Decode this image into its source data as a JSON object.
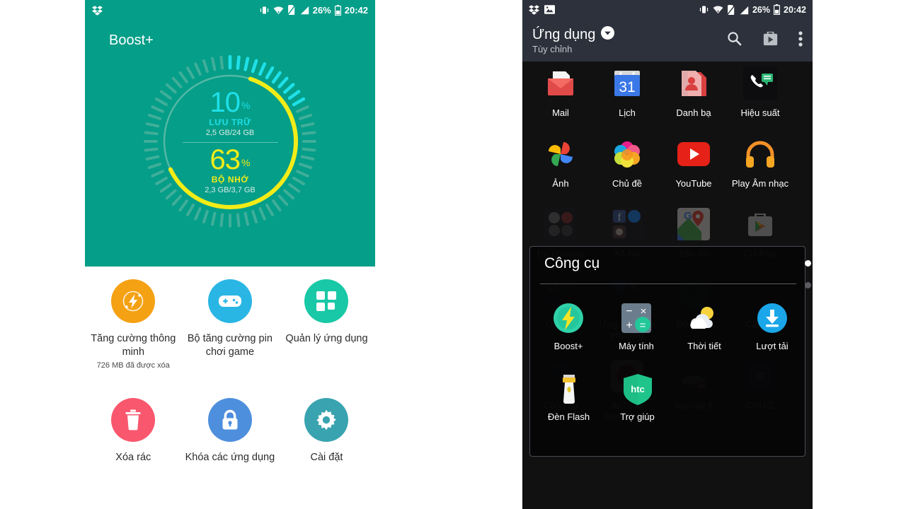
{
  "left_phone": {
    "statusbar": {
      "left_icons": [
        "dropbox-icon"
      ],
      "right_icons": [
        "vibrate-icon",
        "wifi-icon",
        "sd-off-icon",
        "signal-off-icon"
      ],
      "battery_percent": "26%",
      "clock": "20:42"
    },
    "app_title": "Boost+",
    "gauge": {
      "storage": {
        "percent": "10",
        "symbol": "%",
        "label": "LƯU TRỮ",
        "detail": "2,5 GB/24 GB",
        "color": "#1ee0e8",
        "value": 10
      },
      "memory": {
        "percent": "63",
        "symbol": "%",
        "label": "BỘ NHỚ",
        "detail": "2,3 GB/3,7 GB",
        "color": "#f3ec18",
        "value": 63
      }
    },
    "tiles": [
      {
        "label": "Tăng cường thông minh",
        "sub": "726 MB đã được xóa",
        "color": "#f5a114",
        "icon": "boost-bolt-icon"
      },
      {
        "label": "Bộ tăng cường pin chơi game",
        "sub": "",
        "color": "#29b6e5",
        "icon": "gamepad-icon"
      },
      {
        "label": "Quản lý ứng dụng",
        "sub": "",
        "color": "#19c8a6",
        "icon": "app-grid-icon"
      },
      {
        "label": "Xóa rác",
        "sub": "",
        "color": "#f9576e",
        "icon": "trash-icon"
      },
      {
        "label": "Khóa các ứng dụng",
        "sub": "",
        "color": "#4d8fdd",
        "icon": "lock-icon"
      },
      {
        "label": "Cài đặt",
        "sub": "",
        "color": "#39a4b0",
        "icon": "gear-icon"
      }
    ]
  },
  "right_phone": {
    "statusbar": {
      "left_icons": [
        "dropbox-icon",
        "image-icon"
      ],
      "right_icons": [
        "vibrate-icon",
        "wifi-icon",
        "sd-off-icon",
        "signal-off-icon"
      ],
      "battery_percent": "26%",
      "clock": "20:42"
    },
    "actionbar": {
      "title": "Ứng dụng",
      "subtitle": "Tùy chỉnh",
      "dropdown_icon": "chevron-down-icon",
      "actions": [
        "search-icon",
        "play-store-icon",
        "overflow-menu-icon"
      ]
    },
    "home_rows": [
      [
        {
          "label": "Mail",
          "icon": "mail-icon"
        },
        {
          "label": "Lịch",
          "icon": "calendar-31-icon"
        },
        {
          "label": "Danh bạ",
          "icon": "contacts-icon"
        },
        {
          "label": "Hiệu suất",
          "icon": "productivity-folder-icon"
        }
      ],
      [
        {
          "label": "Ảnh",
          "icon": "google-photos-icon"
        },
        {
          "label": "Chủ đề",
          "icon": "themes-icon"
        },
        {
          "label": "YouTube",
          "icon": "youtube-icon"
        },
        {
          "label": "Play Âm nhạc",
          "icon": "play-music-icon"
        }
      ],
      [
        {
          "label": "Đa phương",
          "icon": "multimedia-folder-icon"
        },
        {
          "label": "Xã hội",
          "icon": "social-folder-icon"
        },
        {
          "label": "Bản đồ",
          "icon": "maps-icon"
        },
        {
          "label": "CH Play",
          "icon": "play-store-icon"
        }
      ],
      [
        {
          "label": "Google",
          "icon": "google-folder-icon"
        },
        {
          "label": "Ứng dụng địa phương",
          "icon": "local-apps-folder-icon"
        },
        {
          "label": "Đồng hồ",
          "icon": "clock-icon"
        },
        {
          "label": "Cài đặt",
          "icon": "settings-gear-icon"
        }
      ],
      [
        {
          "label": "Công cụ",
          "icon": "tools-folder-icon"
        },
        {
          "label": "AnTuTu Benchmark",
          "icon": "antutu-icon"
        },
        {
          "label": "Asphalt 8",
          "icon": "asphalt8-icon"
        },
        {
          "label": "CPU-Z",
          "icon": "cpuz-icon"
        }
      ]
    ],
    "folder": {
      "title": "Công cụ",
      "apps": [
        {
          "label": "Boost+",
          "icon": "boost-plus-icon"
        },
        {
          "label": "Máy tính",
          "icon": "calculator-icon"
        },
        {
          "label": "Thời tiết",
          "icon": "weather-icon"
        },
        {
          "label": "Lượt tải",
          "icon": "downloads-icon"
        },
        {
          "label": "Đèn Flash",
          "icon": "flashlight-icon"
        },
        {
          "label": "Trợ giúp",
          "icon": "htc-help-icon"
        }
      ]
    },
    "page_dots": [
      {
        "active": true
      },
      {
        "active": false
      }
    ]
  }
}
